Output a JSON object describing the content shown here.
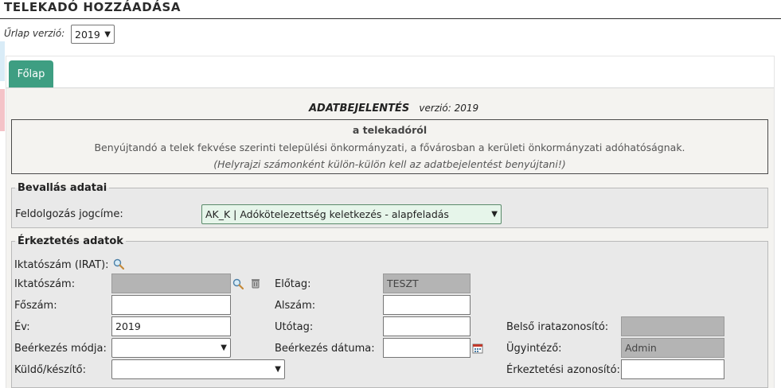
{
  "page": {
    "title": "TELEKADÓ HOZZÁADÁSA"
  },
  "version_row": {
    "label": "Űrlap verzió:",
    "selected": "2019"
  },
  "tabs": [
    {
      "label": "Főlap",
      "active": true
    }
  ],
  "doc": {
    "name": "ADATBEJELENTÉS",
    "version_text": "verzió: 2019",
    "box_title": "a telekadóról",
    "box_line2": "Benyújtandó a telek fekvése szerinti települési önkormányzati, a fővárosban a kerületi önkormányzati adóhatóságnak.",
    "box_line3": "(Helyrajzi számonként külön-külön kell az adatbejelentést benyújtani!)"
  },
  "bevallas": {
    "legend": "Bevallás adatai",
    "jogcim_label": "Feldolgozás jogcíme:",
    "jogcim_value": "AK_K | Adókötelezettség keletkezés - alapfeladás"
  },
  "erkeztetes": {
    "legend": "Érkeztetés adatok",
    "irat_label": "Iktatószám (IRAT):",
    "iktatoszam_label": "Iktatószám:",
    "iktatoszam_value": "",
    "foszam_label": "Főszám:",
    "foszam_value": "",
    "ev_label": "Év:",
    "ev_value": "2019",
    "beerkezes_modja_label": "Beérkezés módja:",
    "beerkezes_modja_value": "",
    "kuldo_label": "Küldő/készítő:",
    "kuldo_value": "",
    "elotag_label": "Előtag:",
    "elotag_value": "TESZT",
    "alszam_label": "Alszám:",
    "alszam_value": "",
    "utotag_label": "Utótag:",
    "utotag_value": "",
    "beerkezes_datuma_label": "Beérkezés dátuma:",
    "beerkezes_datuma_value": "",
    "belso_label": "Belső iratazonosító:",
    "belso_value": "",
    "ugyintezo_label": "Ügyintéző:",
    "ugyintezo_value": "Admin",
    "erk_azon_label": "Érkeztetési azonosító:",
    "erk_azon_value": ""
  },
  "icons": {
    "search": "magnifier-icon",
    "delete": "trash-icon",
    "calendar": "calendar-icon",
    "dropdown": "chevron-down-icon"
  },
  "colors": {
    "accent": "#3e9e82",
    "panel": "#f4f3f0",
    "fieldset": "#e9e9e9",
    "readonly": "#b4b4b4"
  }
}
